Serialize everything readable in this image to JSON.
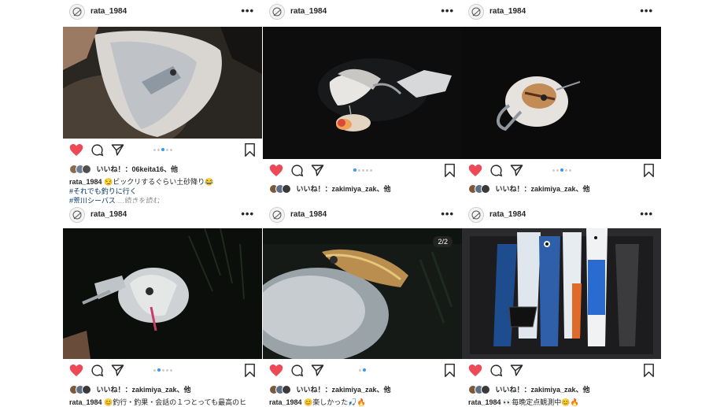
{
  "colors": {
    "heart": "#ed4956",
    "tag": "#003569",
    "dot_active": "#3897f0"
  },
  "posts": [
    {
      "username": "rata_1984",
      "more": "•••",
      "likes": "いいね！：06keita16、他",
      "caption_user": "rata_1984",
      "caption_text": "😏ビックリするぐらい土砂降り😂",
      "hashtag1": "#それでも釣りに行く",
      "hashtag2": "#荒川シーバス",
      "more_text": "…続きを読む",
      "carousel_dots": 5,
      "carousel_active": 3,
      "photo_desc": "lure-in-net"
    },
    {
      "username": "rata_1984",
      "more": "•••",
      "likes": "いいね！：zakimiya_zak、他",
      "carousel_dots": 5,
      "carousel_active": 1,
      "photo_desc": "lure-on-fish-night"
    },
    {
      "username": "rata_1984",
      "more": "•••",
      "likes": "いいね！：zakimiya_zak、他",
      "carousel_dots": 5,
      "carousel_active": 3,
      "photo_desc": "fish-with-grip-night"
    },
    {
      "username": "rata_1984",
      "more": "•••",
      "likes": "いいね！：zakimiya_zak、他",
      "caption_user": "rata_1984",
      "caption_text": "😊釣行・釣果・会話の１つとっても最高のヒ",
      "carousel_dots": 5,
      "carousel_active": 1,
      "photo_desc": "fish-with-grip-grass"
    },
    {
      "username": "rata_1984",
      "more": "•••",
      "likes": "いいね！：zakimiya_zak、他",
      "caption_user": "rata_1984",
      "caption_text": "😊楽しかった🎣🔥",
      "counter": "2/2",
      "carousel_dots": 2,
      "carousel_active": 1,
      "photo_desc": "minnow-in-fish-mouth"
    },
    {
      "username": "rata_1984",
      "more": "•••",
      "likes": "いいね！：zakimiya_zak、他",
      "caption_user": "rata_1984",
      "caption_text": "👀毎晩定点観測中😊🔥",
      "photo_desc": "tackle-box-lures"
    }
  ]
}
